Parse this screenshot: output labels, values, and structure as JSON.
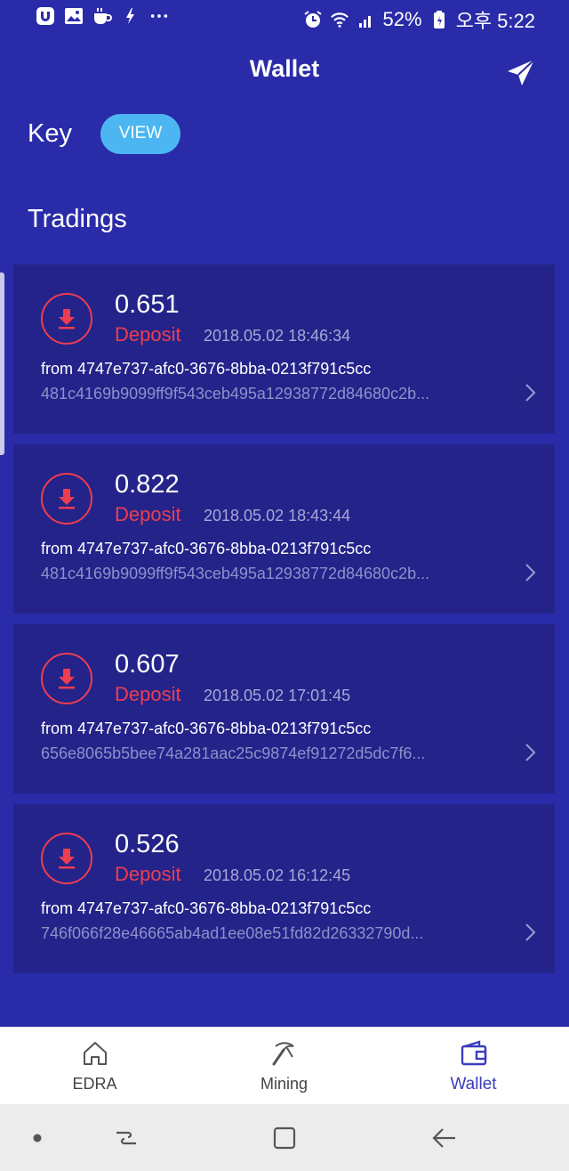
{
  "status_bar": {
    "battery": "52%",
    "time": "오후 5:22",
    "left_icons": [
      "app-icon",
      "image-icon",
      "coffee-icon",
      "flash-icon",
      "more-icon"
    ],
    "right_icons": [
      "alarm-icon",
      "wifi-icon",
      "signal-icon",
      "battery-icon"
    ]
  },
  "header": {
    "title": "Wallet",
    "action_icon": "send-icon"
  },
  "key": {
    "label": "Key",
    "button": "VIEW"
  },
  "section": {
    "title": "Tradings"
  },
  "colors": {
    "background": "#2a2ba8",
    "card": "#23238a",
    "accent_red": "#ee3d4f",
    "button_blue": "#4cb6f2",
    "active_nav": "#3a3dbe"
  },
  "tradings": [
    {
      "amount": "0.651",
      "type": "Deposit",
      "date": "2018.05.02 18:46:34",
      "from": "from 4747e737-afc0-3676-8bba-0213f791c5cc",
      "hash": "481c4169b9099ff9f543ceb495a12938772d84680c2b..."
    },
    {
      "amount": "0.822",
      "type": "Deposit",
      "date": "2018.05.02 18:43:44",
      "from": "from 4747e737-afc0-3676-8bba-0213f791c5cc",
      "hash": "481c4169b9099ff9f543ceb495a12938772d84680c2b..."
    },
    {
      "amount": "0.607",
      "type": "Deposit",
      "date": "2018.05.02 17:01:45",
      "from": "from 4747e737-afc0-3676-8bba-0213f791c5cc",
      "hash": "656e8065b5bee74a281aac25c9874ef91272d5dc7f6..."
    },
    {
      "amount": "0.526",
      "type": "Deposit",
      "date": "2018.05.02 16:12:45",
      "from": "from 4747e737-afc0-3676-8bba-0213f791c5cc",
      "hash": "746f066f28e46665ab4ad1ee08e51fd82d26332790d..."
    }
  ],
  "bottom_nav": [
    {
      "label": "EDRA",
      "icon": "home-icon",
      "active": false
    },
    {
      "label": "Mining",
      "icon": "pickaxe-icon",
      "active": false
    },
    {
      "label": "Wallet",
      "icon": "wallet-icon",
      "active": true
    }
  ]
}
